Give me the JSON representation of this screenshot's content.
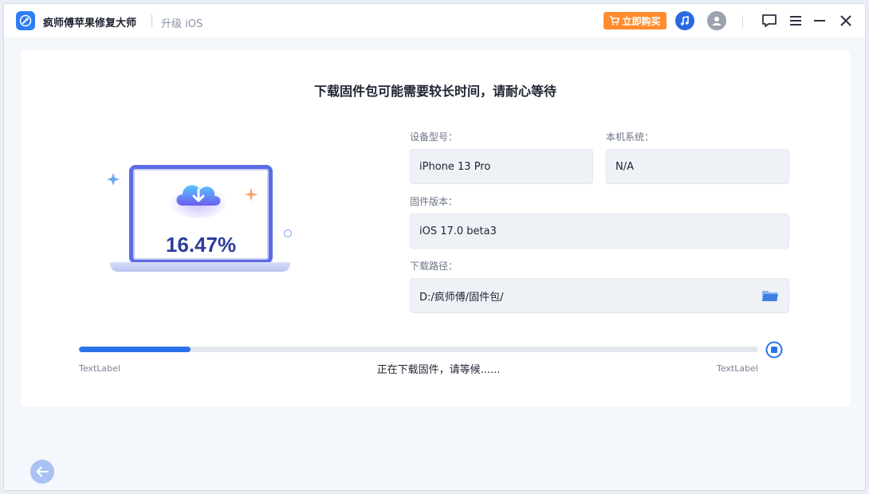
{
  "titlebar": {
    "app_name": "疯师傅苹果修复大师",
    "mode": "升级 iOS",
    "buy_label": "立即购买",
    "icons": [
      "wrench-logo-icon",
      "cart-icon",
      "music-icon",
      "user-icon",
      "feedback-icon",
      "menu-icon",
      "minimize-icon",
      "close-icon"
    ]
  },
  "main": {
    "headline": "下载固件包可能需要较长时间，请耐心等待",
    "progress_percent_text": "16.47%",
    "device_model_label": "设备型号：",
    "device_model_value": "iPhone 13 Pro",
    "system_label": "本机系统：",
    "system_value": "N/A",
    "firmware_label": "固件版本：",
    "firmware_value": "iOS 17.0 beta3",
    "path_label": "下载路径：",
    "path_value": "D:/疯师傅/固件包/",
    "progress_fraction": 0.1647,
    "text_label_left": "TextLabel",
    "text_label_right": "TextLabel",
    "status": "正在下载固件，请等候......"
  },
  "colors": {
    "accent": "#2a73ea",
    "buy": "#ff8c2e",
    "laptop": "#5b6ce6"
  }
}
